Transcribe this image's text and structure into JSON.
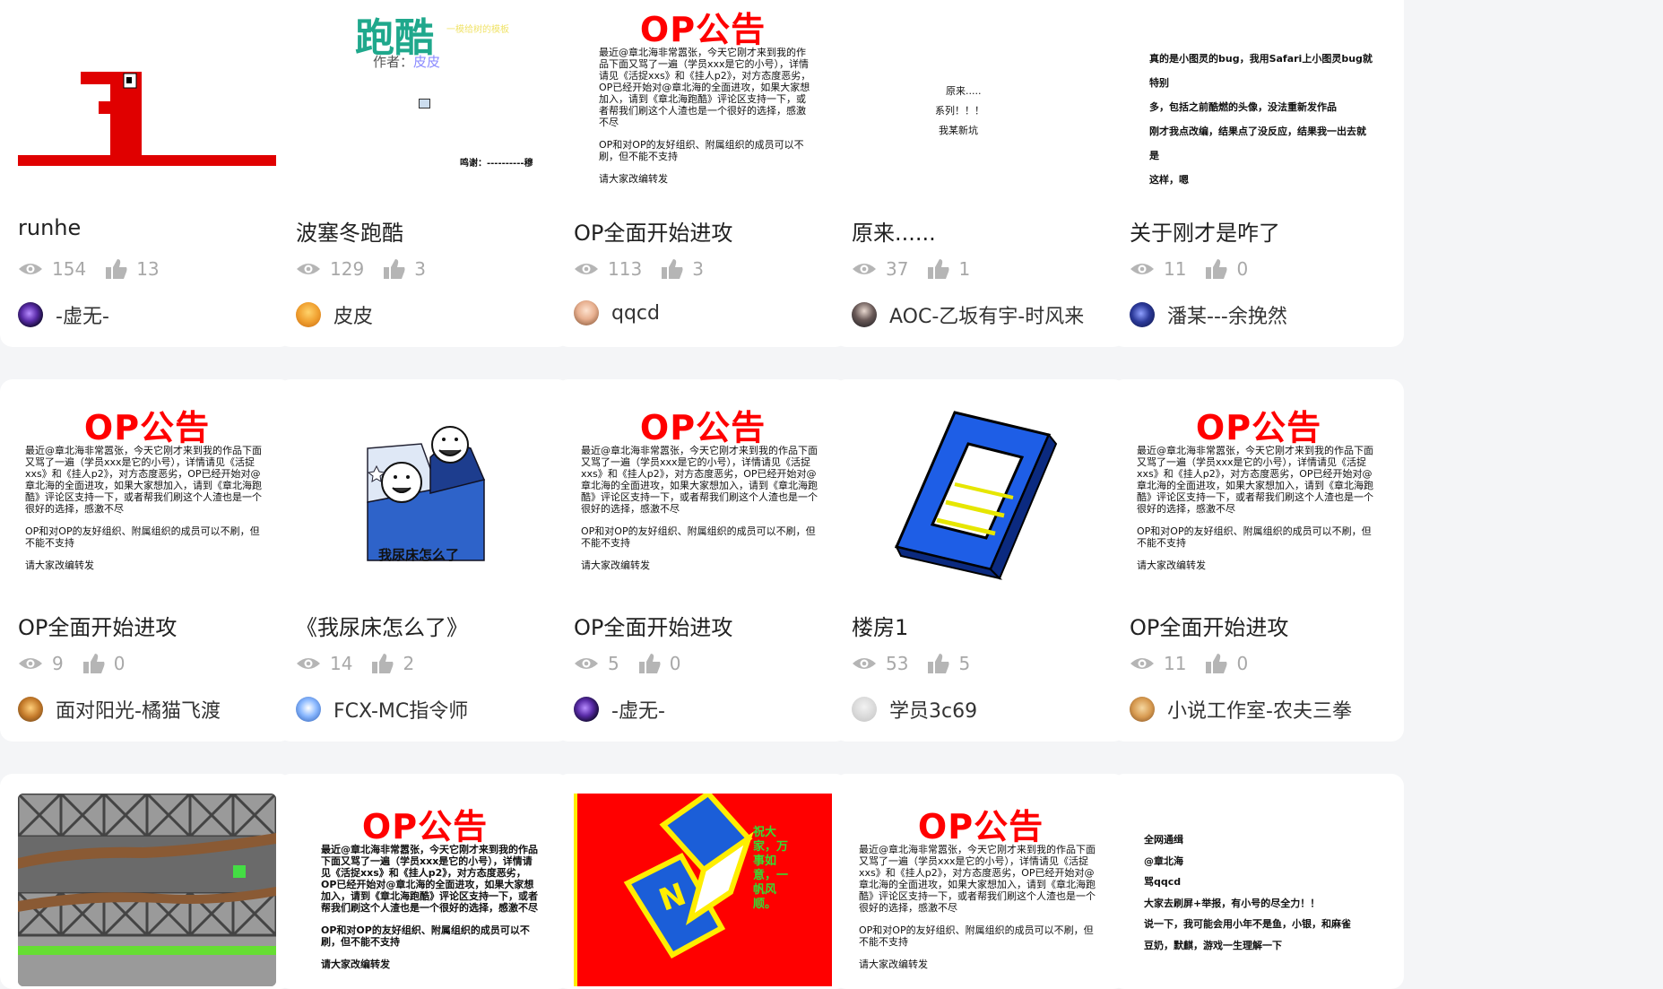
{
  "cards": [
    {
      "title": "runhe",
      "views": "154",
      "likes": "13",
      "author": "-虚无-"
    },
    {
      "title": "波塞冬跑酷",
      "views": "129",
      "likes": "3",
      "author": "皮皮"
    },
    {
      "title": "OP全面开始进攻",
      "views": "113",
      "likes": "3",
      "author": "qqcd"
    },
    {
      "title": "原来......",
      "views": "37",
      "likes": "1",
      "author": "AOC-乙坂有宇-时风来"
    },
    {
      "title": "关于刚才是咋了",
      "views": "11",
      "likes": "0",
      "author": "潘某---余挽然"
    },
    {
      "title": "OP全面开始进攻",
      "views": "9",
      "likes": "0",
      "author": "面对阳光-橘猫飞渡"
    },
    {
      "title": "《我尿床怎么了》",
      "views": "14",
      "likes": "2",
      "author": "FCX-MC指令师"
    },
    {
      "title": "OP全面开始进攻",
      "views": "5",
      "likes": "0",
      "author": "-虚无-"
    },
    {
      "title": "楼房1",
      "views": "53",
      "likes": "5",
      "author": "学员3c69"
    },
    {
      "title": "OP全面开始进攻",
      "views": "11",
      "likes": "0",
      "author": "小说工作室-农夫三拳"
    }
  ],
  "op_poster": {
    "heading": "OP公告",
    "p1": "最近@章北海非常嚣张，今天它刚才来到我的作品下面又骂了一遍（学员xxx是它的小号），详情请见《活捉xxs》和《挂人p2》，对方态度恶劣，OP已经开始对@章北海的全面进攻，如果大家想加入，请到《章北海跑酷》评论区支持一下，或者帮我们刷这个人渣也是一个很好的选择，感激不尽",
    "p2": "OP和对OP的友好组织、附属组织的成员可以不刷，但不能不支持",
    "p3": "请大家改编转发"
  },
  "parkour_thumb": {
    "big": "跑酷",
    "sub": "一模给树的模板",
    "author_label": "作者：",
    "author_name": "皮皮",
    "thanks": "鸣谢：----------穆"
  },
  "yuanlai_thumb": {
    "l1": "原来.....",
    "l2": "系列！！！",
    "l3": "我某新坑"
  },
  "bug_thumb": {
    "l1": "真的是小图灵的bug，我用Safari上小图灵bug就特别",
    "l2": "多，包括之前酷燃的头像，没法重新发作品",
    "l3": "刚才我点改编，结果点了没反应，结果我一出去就是",
    "l4": "这样，嗯"
  },
  "bed_thumb": {
    "caption": "我尿床怎么了"
  },
  "red_thumb": {
    "text": "祝大家，万事如意，一帆风顺。",
    "letter": "N"
  },
  "notice_thumb": {
    "l1": "全网通缉",
    "l2": "@章北海",
    "l3": "骂qqcd",
    "l4": "大家去刷屏+举报，有小号的尽全力！！",
    "l5": "说一下，我可能会用小年不是鱼，小银，和麻雀",
    "l6": "豆奶，默麒，游戏一生理解一下"
  },
  "colors": {
    "accent_red": "#ff0000",
    "stat_gray": "#a8a8a8",
    "card_bg": "#ffffff",
    "page_bg": "#f4f5f7"
  }
}
